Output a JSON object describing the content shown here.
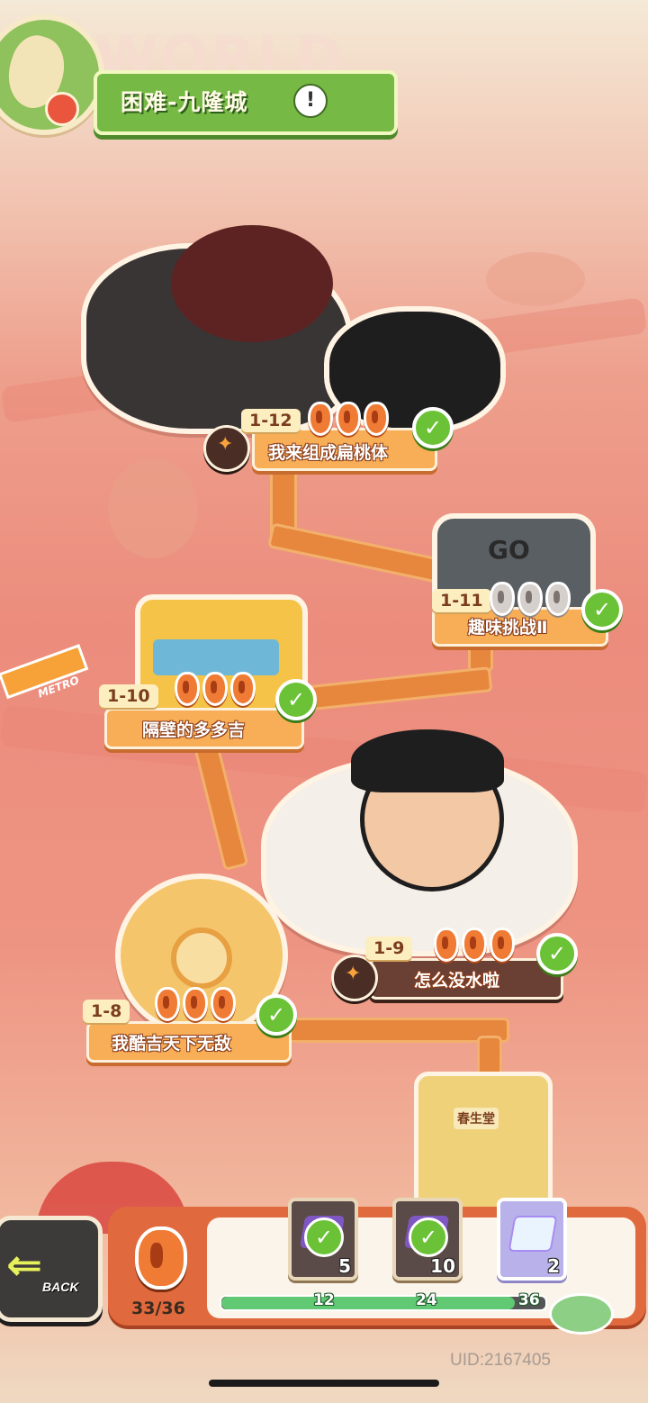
{
  "header": {
    "bg_text": "WORLD",
    "title": "困难-九隆城",
    "alert_glyph": "!"
  },
  "levels": [
    {
      "id": "1-12",
      "name": "我来组成扁桃体",
      "stars": 3,
      "cleared": true,
      "boss": true
    },
    {
      "id": "1-11",
      "name": "趣味挑战Ⅱ",
      "stars": 3,
      "cleared": true,
      "boss": false,
      "grey": true
    },
    {
      "id": "1-10",
      "name": "隔壁的多多吉",
      "stars": 3,
      "cleared": true,
      "boss": false
    },
    {
      "id": "1-9",
      "name": "怎么没水啦",
      "stars": 3,
      "cleared": true,
      "boss": true
    },
    {
      "id": "1-8",
      "name": "我酷吉天下无敌",
      "stars": 3,
      "cleared": true,
      "boss": false
    }
  ],
  "decor": {
    "metro_label": "METRO",
    "game_screen_label": "GO",
    "building_sign": "春生堂"
  },
  "hud": {
    "back_label": "BACK",
    "foot_count": "33/36",
    "progress": 0.917,
    "rewards": [
      {
        "milestone": "12",
        "count": "5",
        "claimed": true
      },
      {
        "milestone": "24",
        "count": "10",
        "claimed": true
      },
      {
        "milestone": "36",
        "count": "2",
        "claimed": false
      }
    ]
  },
  "uid": "UID:2167405",
  "check_glyph": "✓"
}
